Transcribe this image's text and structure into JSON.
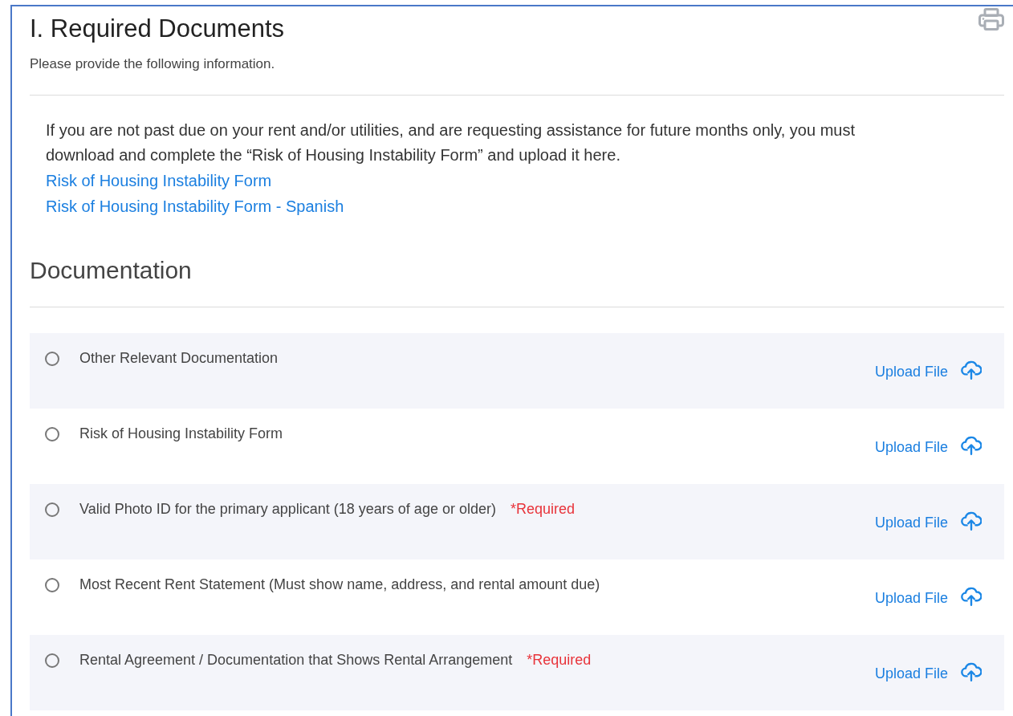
{
  "section": {
    "title": "I. Required Documents",
    "subtitle": "Please provide the following information."
  },
  "notice": {
    "text": "If you are not past due on your rent and/or utilities, and are requesting assistance for future months only, you must download and complete the “Risk of Housing Instability Form” and upload it here.",
    "links": [
      "Risk of Housing Instability Form",
      "Risk of Housing Instability Form - Spanish"
    ]
  },
  "documentation": {
    "heading": "Documentation",
    "items": [
      {
        "label": "Other Relevant Documentation",
        "selected": false,
        "upload": "Upload File"
      },
      {
        "label": "Risk of Housing Instability Form",
        "selected": false,
        "upload": "Upload File"
      },
      {
        "label": "Valid Photo ID for the primary applicant (18 years of age or older)",
        "required": "*Required",
        "selected": false,
        "upload": "Upload File"
      },
      {
        "label": "Most Recent Rent Statement (Must show name, address, and rental amount due)",
        "selected": false,
        "upload": "Upload File"
      },
      {
        "label": "Rental Agreement / Documentation that Shows Rental Arrangement",
        "required": "*Required",
        "selected": false,
        "upload": "Upload File"
      }
    ]
  }
}
